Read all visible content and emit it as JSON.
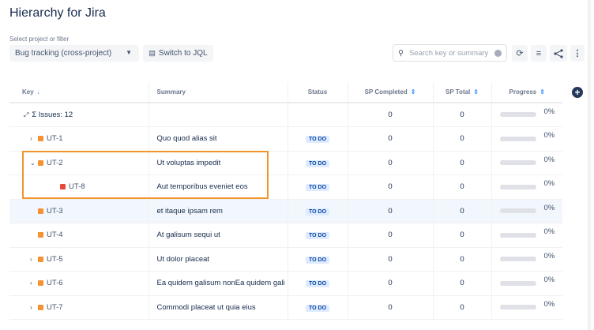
{
  "title": "Hierarchy for Jira",
  "filter": {
    "label": "Select project or filter",
    "selected": "Bug tracking (cross-project)",
    "switch_jql": "Switch to JQL"
  },
  "search": {
    "placeholder": "Search key or summary"
  },
  "toolbar": {
    "icons": [
      "refresh-icon",
      "sort-icon",
      "share-icon",
      "more-icon"
    ]
  },
  "columns": [
    "Key",
    "Summary",
    "Status",
    "SP Completed",
    "SP Total",
    "Progress"
  ],
  "summary_row": {
    "label": "Σ Issues: 12",
    "sp_completed": "0",
    "sp_total": "0",
    "progress": 0,
    "progress_label": "0%"
  },
  "colors": {
    "story": "#f79232",
    "bug": "#e5493a",
    "highlight": "#f0962d"
  },
  "rows": [
    {
      "key": "UT-1",
      "summary": "Quo quod alias sit",
      "status": "TO DO",
      "sp_completed": "0",
      "sp_total": "0",
      "progress": 0,
      "progress_label": "0%",
      "type": "story",
      "toggle": "›",
      "level": 0
    },
    {
      "key": "UT-2",
      "summary": "Ut voluptas impedit",
      "status": "TO DO",
      "sp_completed": "0",
      "sp_total": "0",
      "progress": 0,
      "progress_label": "0%",
      "type": "story",
      "toggle": "⌄",
      "level": 0
    },
    {
      "key": "UT-8",
      "summary": "Aut temporibus eveniet eos",
      "status": "TO DO",
      "sp_completed": "0",
      "sp_total": "0",
      "progress": 0,
      "progress_label": "0%",
      "type": "bug",
      "toggle": "",
      "level": 1
    },
    {
      "key": "UT-3",
      "summary": "et itaque ipsam rem",
      "status": "TO DO",
      "sp_completed": "0",
      "sp_total": "0",
      "progress": 0,
      "progress_label": "0%",
      "type": "story",
      "toggle": "",
      "level": 0
    },
    {
      "key": "UT-4",
      "summary": "At galisum sequi ut",
      "status": "TO DO",
      "sp_completed": "0",
      "sp_total": "0",
      "progress": 0,
      "progress_label": "0%",
      "type": "story",
      "toggle": "",
      "level": 0
    },
    {
      "key": "UT-5",
      "summary": "Ut dolor placeat",
      "status": "TO DO",
      "sp_completed": "0",
      "sp_total": "0",
      "progress": 0,
      "progress_label": "0%",
      "type": "story",
      "toggle": "›",
      "level": 0
    },
    {
      "key": "UT-6",
      "summary": "Ea quidem galisum nonEa quidem gali",
      "status": "TO DO",
      "sp_completed": "0",
      "sp_total": "0",
      "progress": 0,
      "progress_label": "0%",
      "type": "story",
      "toggle": "›",
      "level": 0
    },
    {
      "key": "UT-7",
      "summary": "Commodi placeat ut quia eius",
      "status": "TO DO",
      "sp_completed": "0",
      "sp_total": "0",
      "progress": 0,
      "progress_label": "0%",
      "type": "story",
      "toggle": "›",
      "level": 0
    }
  ]
}
